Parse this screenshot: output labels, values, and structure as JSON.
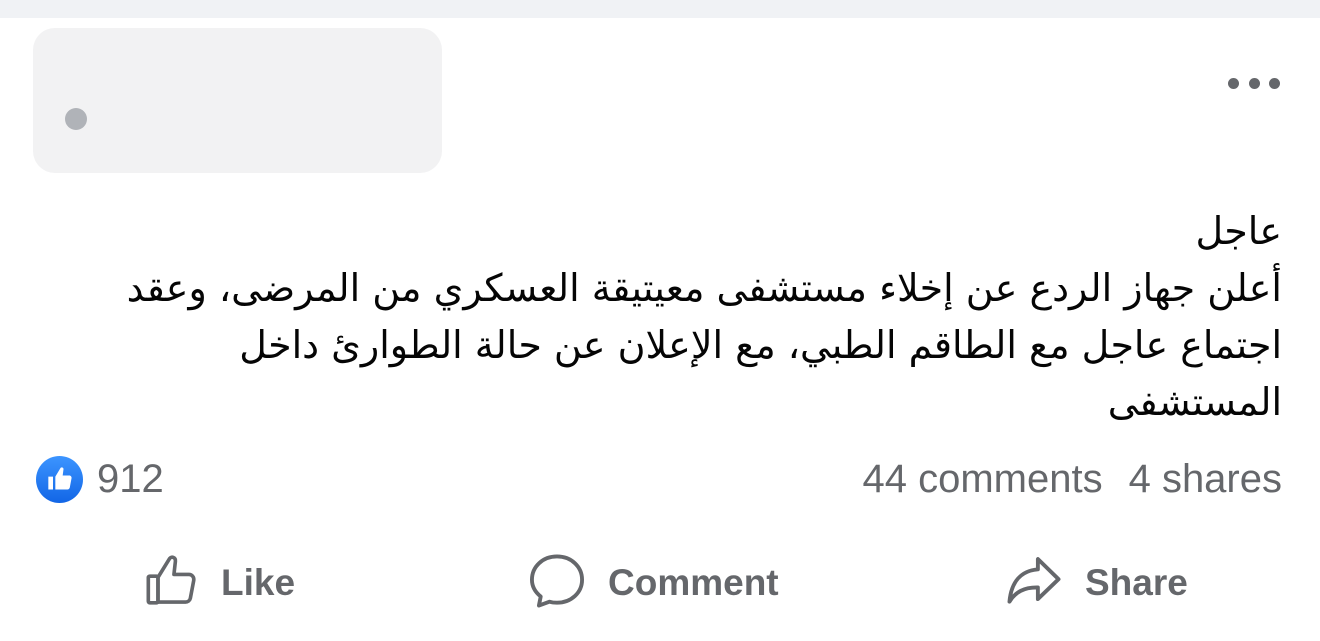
{
  "post": {
    "text_lines": [
      "عاجل",
      "أعلن جهاز الردع عن إخلاء مستشفى معيتيقة العسكري من المرضى، وعقد",
      "اجتماع عاجل مع الطاقم الطبي، مع الإعلان عن حالة الطوارئ داخل",
      "المستشفى"
    ]
  },
  "stats": {
    "reaction_count": "912",
    "comments": "44 comments",
    "shares": "4 shares"
  },
  "actions": {
    "like": "Like",
    "comment": "Comment",
    "share": "Share"
  },
  "icons": {
    "reaction": "like-reaction-icon",
    "more": "more-options-icon",
    "like": "thumbs-up-icon",
    "comment": "speech-bubble-icon",
    "share": "share-arrow-icon"
  },
  "colors": {
    "accent": "#1877f2",
    "text": "#050505",
    "muted": "#65676b"
  }
}
